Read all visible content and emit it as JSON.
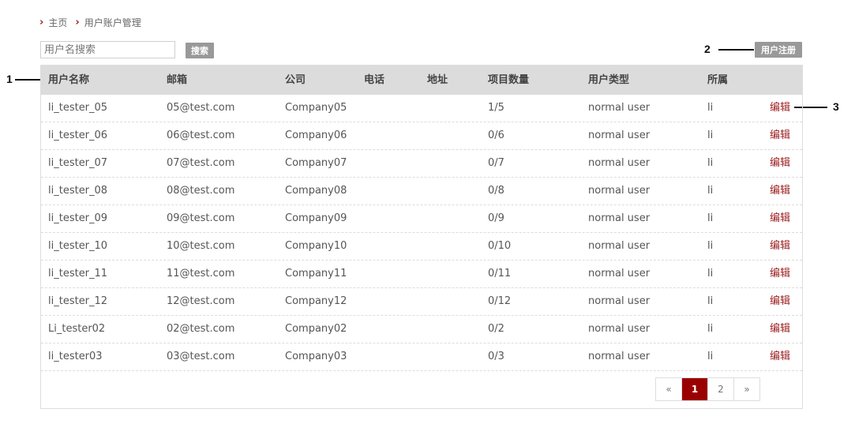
{
  "breadcrumb": {
    "home": "主页",
    "current": "用户账户管理"
  },
  "search": {
    "placeholder": "用户名搜索",
    "value": "",
    "button_label": "搜索"
  },
  "register_button_label": "用户注册",
  "callouts": {
    "c1": "1",
    "c2": "2",
    "c3": "3"
  },
  "table": {
    "columns": [
      "用户名称",
      "邮箱",
      "公司",
      "电话",
      "地址",
      "项目数量",
      "用户类型",
      "所属"
    ],
    "edit_label": "编辑",
    "rows": [
      {
        "name": "li_tester_05",
        "email": "05@test.com",
        "company": "Company05",
        "phone": "",
        "address": "",
        "projects": "1/5",
        "type": "normal user",
        "owner": "li"
      },
      {
        "name": "li_tester_06",
        "email": "06@test.com",
        "company": "Company06",
        "phone": "",
        "address": "",
        "projects": "0/6",
        "type": "normal user",
        "owner": "li"
      },
      {
        "name": "li_tester_07",
        "email": "07@test.com",
        "company": "Company07",
        "phone": "",
        "address": "",
        "projects": "0/7",
        "type": "normal user",
        "owner": "li"
      },
      {
        "name": "li_tester_08",
        "email": "08@test.com",
        "company": "Company08",
        "phone": "",
        "address": "",
        "projects": "0/8",
        "type": "normal user",
        "owner": "li"
      },
      {
        "name": "li_tester_09",
        "email": "09@test.com",
        "company": "Company09",
        "phone": "",
        "address": "",
        "projects": "0/9",
        "type": "normal user",
        "owner": "li"
      },
      {
        "name": "li_tester_10",
        "email": "10@test.com",
        "company": "Company10",
        "phone": "",
        "address": "",
        "projects": "0/10",
        "type": "normal user",
        "owner": "li"
      },
      {
        "name": "li_tester_11",
        "email": "11@test.com",
        "company": "Company11",
        "phone": "",
        "address": "",
        "projects": "0/11",
        "type": "normal user",
        "owner": "li"
      },
      {
        "name": "li_tester_12",
        "email": "12@test.com",
        "company": "Company12",
        "phone": "",
        "address": "",
        "projects": "0/12",
        "type": "normal user",
        "owner": "li"
      },
      {
        "name": "Li_tester02",
        "email": "02@test.com",
        "company": "Company02",
        "phone": "",
        "address": "",
        "projects": "0/2",
        "type": "normal user",
        "owner": "li"
      },
      {
        "name": "li_tester03",
        "email": "03@test.com",
        "company": "Company03",
        "phone": "",
        "address": "",
        "projects": "0/3",
        "type": "normal user",
        "owner": "li"
      }
    ]
  },
  "pagination": {
    "prev": "«",
    "pages": [
      "1",
      "2"
    ],
    "current": "1",
    "next": "»"
  },
  "colors": {
    "accent": "#9b0000",
    "header_bg": "#dcdcdc",
    "button_gray": "#999999"
  }
}
